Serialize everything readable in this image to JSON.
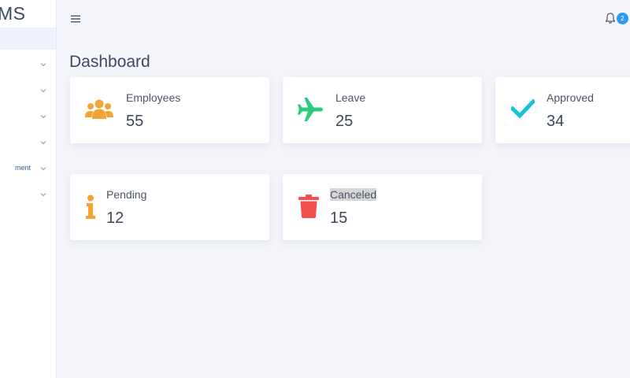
{
  "sidebar": {
    "brand": "MS",
    "items": [
      {
        "label": ""
      },
      {
        "label": ""
      },
      {
        "label": ""
      },
      {
        "label": ""
      },
      {
        "label": "ment"
      },
      {
        "label": ""
      }
    ]
  },
  "header": {
    "notification_count": "2"
  },
  "main": {
    "title": "Dashboard",
    "cards": [
      {
        "label": "Employees",
        "value": "55",
        "icon": "users-icon",
        "color": "#f1a534"
      },
      {
        "label": "Leave",
        "value": "25",
        "icon": "airplane-icon",
        "color": "#2fcb7a"
      },
      {
        "label": "Approved",
        "value": "34",
        "icon": "checkmark-icon",
        "color": "#18c0d8"
      },
      {
        "label": "Pending",
        "value": "12",
        "icon": "info-icon",
        "color": "#f1a534"
      },
      {
        "label": "Canceled",
        "value": "15",
        "icon": "trash-icon",
        "color": "#f0514f"
      }
    ]
  }
}
